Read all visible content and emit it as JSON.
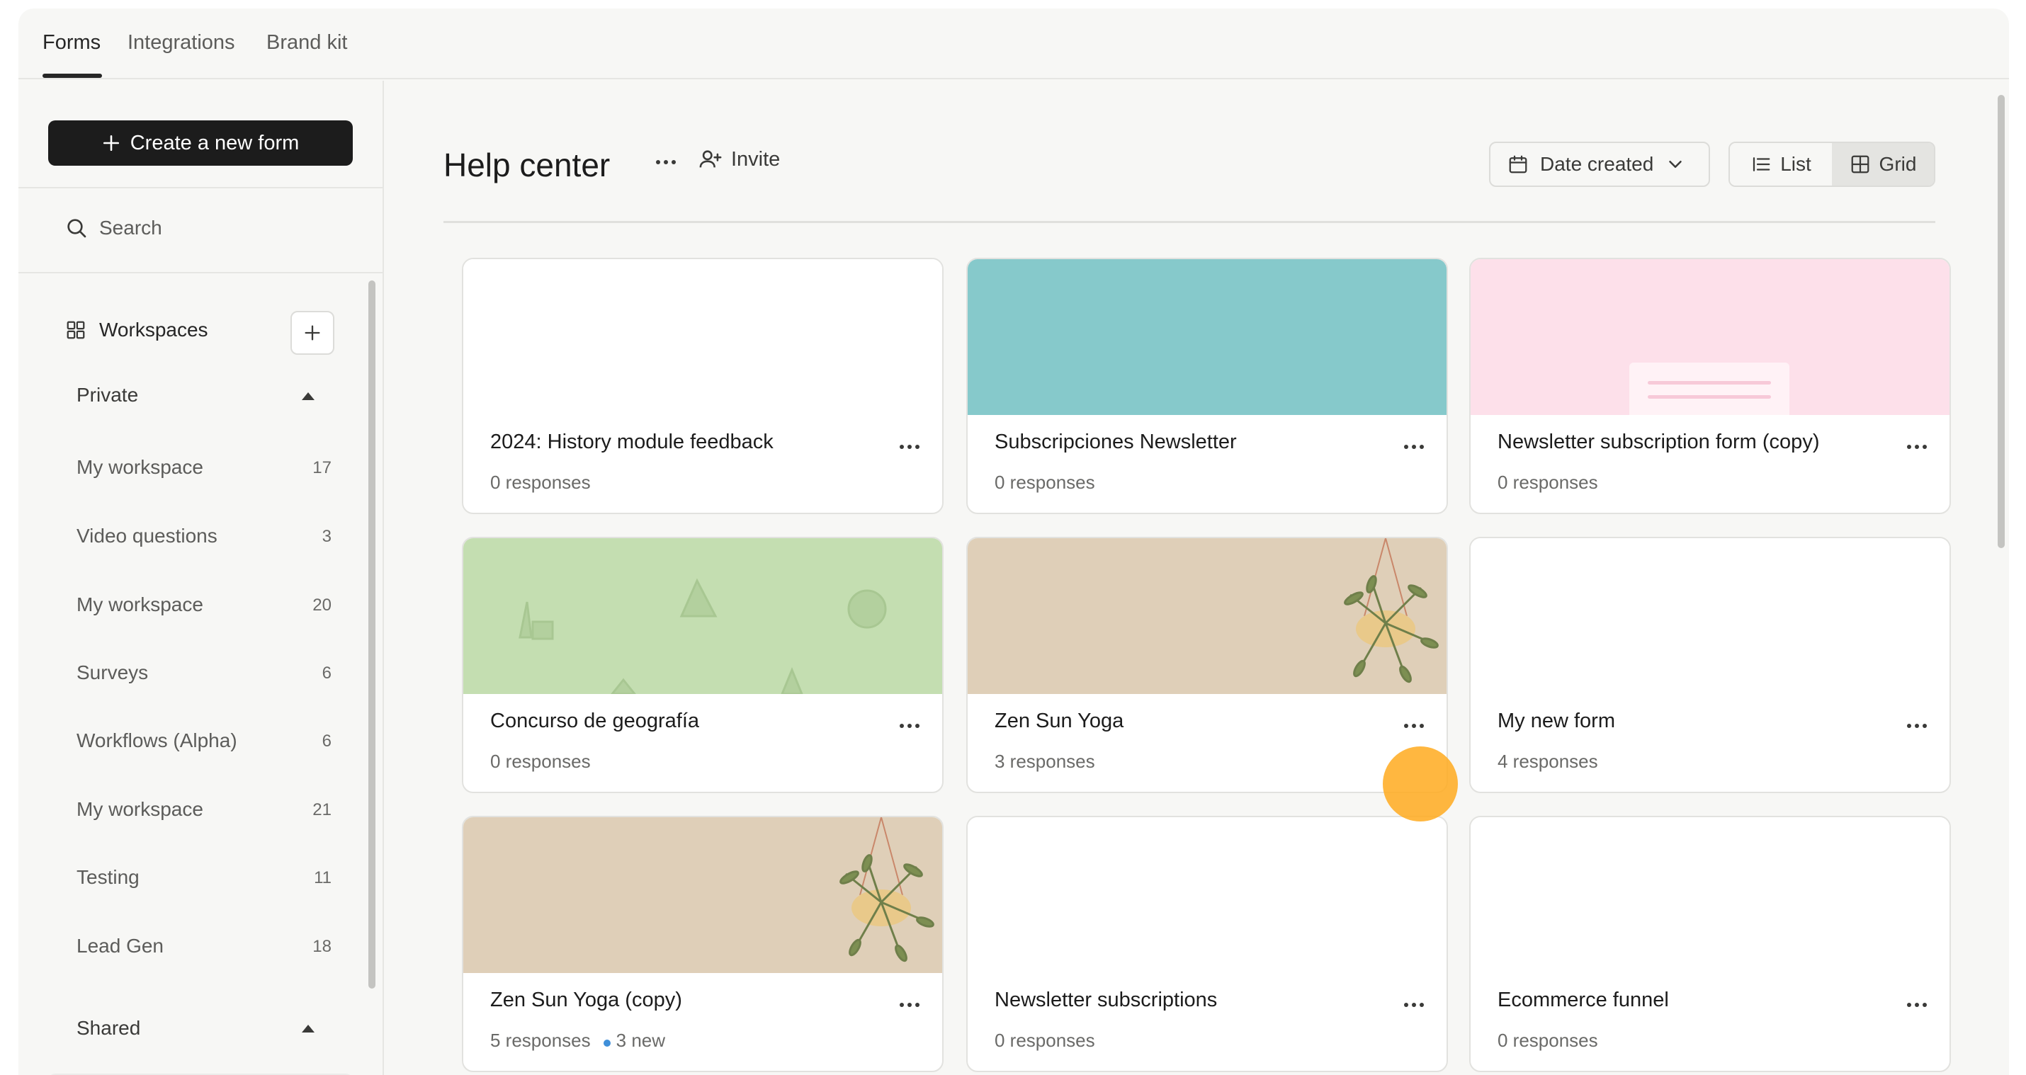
{
  "top_tabs": [
    {
      "label": "Forms",
      "active": true
    },
    {
      "label": "Integrations",
      "active": false
    },
    {
      "label": "Brand kit",
      "active": false
    }
  ],
  "sidebar": {
    "create_label": "Create a new form",
    "search_label": "Search",
    "workspaces_label": "Workspaces",
    "private_label": "Private",
    "shared_label": "Shared",
    "items": [
      {
        "label": "My workspace",
        "count": "17"
      },
      {
        "label": "Video questions",
        "count": "3"
      },
      {
        "label": "My workspace",
        "count": "20"
      },
      {
        "label": "Surveys",
        "count": "6"
      },
      {
        "label": "Workflows (Alpha)",
        "count": "6"
      },
      {
        "label": "My workspace",
        "count": "21"
      },
      {
        "label": "Testing",
        "count": "11"
      },
      {
        "label": "Lead Gen",
        "count": "18"
      }
    ]
  },
  "header": {
    "title": "Help center",
    "invite_label": "Invite",
    "sort_label": "Date created",
    "view_list_label": "List",
    "view_grid_label": "Grid",
    "active_view": "Grid"
  },
  "forms": [
    {
      "title": "2024: History module feedback",
      "responses": "0 responses",
      "cover": "blank",
      "cover_color": "#ffffff"
    },
    {
      "title": "Subscripciones Newsletter",
      "responses": "0 responses",
      "cover": "solid",
      "cover_color": "#86c9cb"
    },
    {
      "title": "Newsletter subscription form (copy)",
      "responses": "0 responses",
      "cover": "pink-card",
      "cover_color": "#fde0ea"
    },
    {
      "title": "Concurso de geografía",
      "responses": "0 responses",
      "cover": "green-pattern",
      "cover_color": "#c4deb1"
    },
    {
      "title": "Zen Sun Yoga",
      "responses": "3 responses",
      "cover": "plant",
      "cover_color": "#dfcfb8"
    },
    {
      "title": "My new form",
      "responses": "4 responses",
      "cover": "blank",
      "cover_color": "#ffffff"
    },
    {
      "title": "Zen Sun Yoga (copy)",
      "responses": "5 responses",
      "new_label": "3 new",
      "cover": "plant",
      "cover_color": "#dfcfb8"
    },
    {
      "title": "Newsletter subscriptions",
      "responses": "0 responses",
      "cover": "blank",
      "cover_color": "#ffffff"
    },
    {
      "title": "Ecommerce funnel",
      "responses": "0 responses",
      "cover": "blank",
      "cover_color": "#ffffff"
    }
  ],
  "colors": {
    "accent_dark": "#1c1c1c",
    "new_indicator": "#3f8fd9",
    "cursor_highlight": "#ffaa1e"
  }
}
